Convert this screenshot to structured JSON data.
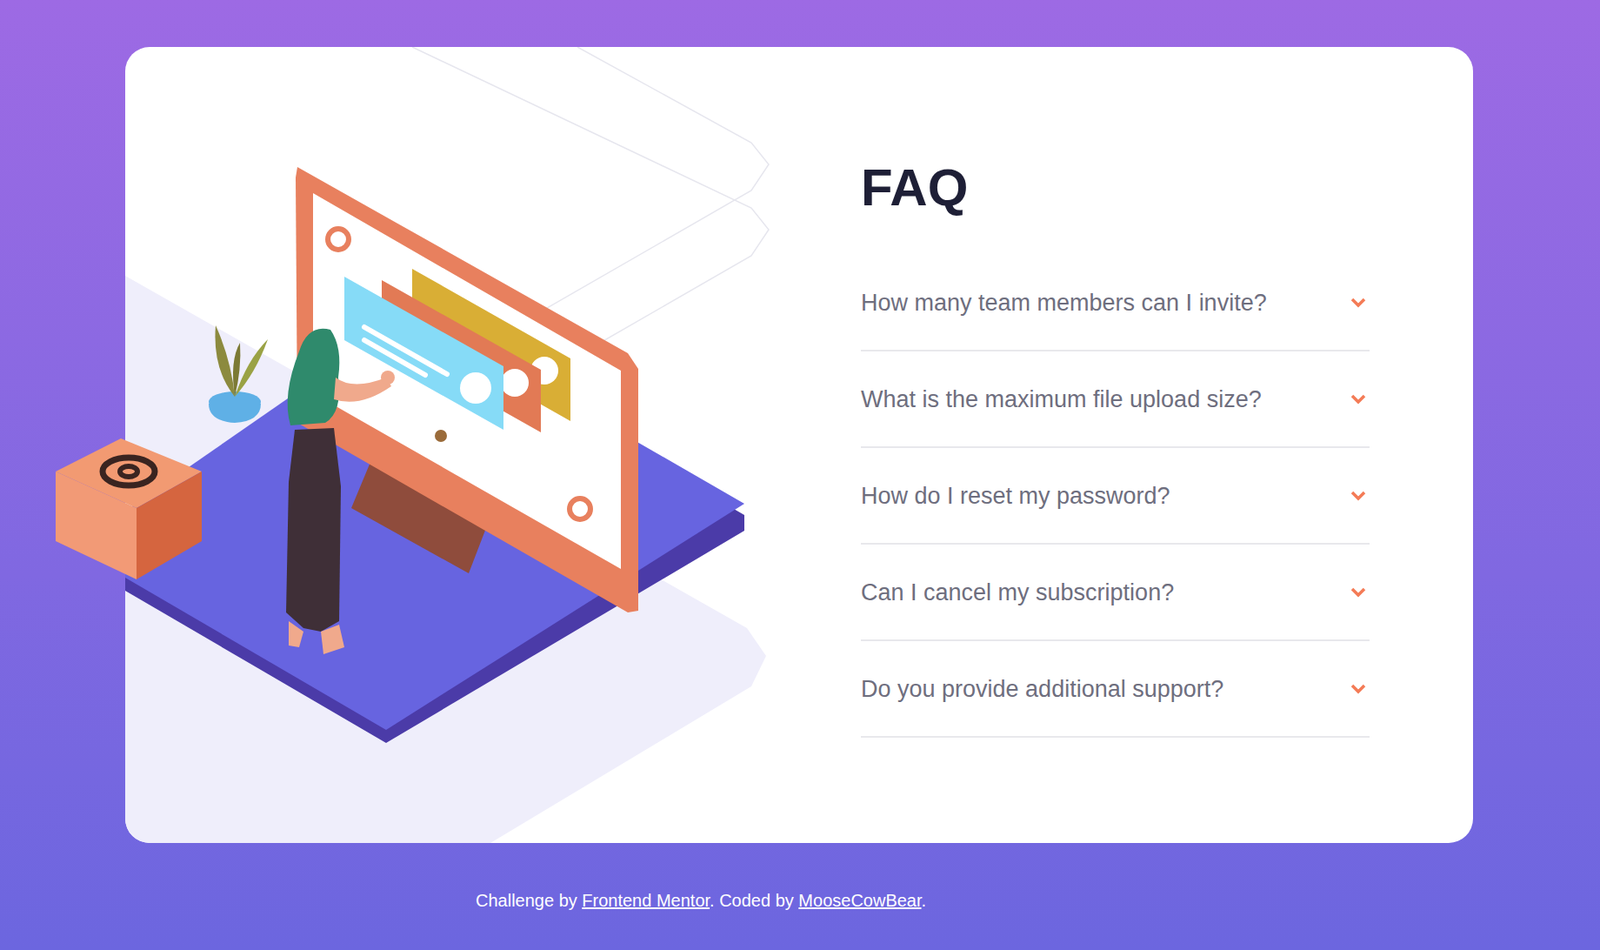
{
  "heading": "FAQ",
  "questions": [
    {
      "text": "How many team members can I invite?",
      "expanded": false
    },
    {
      "text": "What is the maximum file upload size?",
      "expanded": false
    },
    {
      "text": "How do I reset my password?",
      "expanded": false
    },
    {
      "text": "Can I cancel my subscription?",
      "expanded": false
    },
    {
      "text": "Do you provide additional support?",
      "expanded": false
    }
  ],
  "footer": {
    "prefix": "Challenge by ",
    "link1": "Frontend Mentor",
    "middle": ". Coded by ",
    "link2": "MooseCowBear",
    "suffix": "."
  }
}
